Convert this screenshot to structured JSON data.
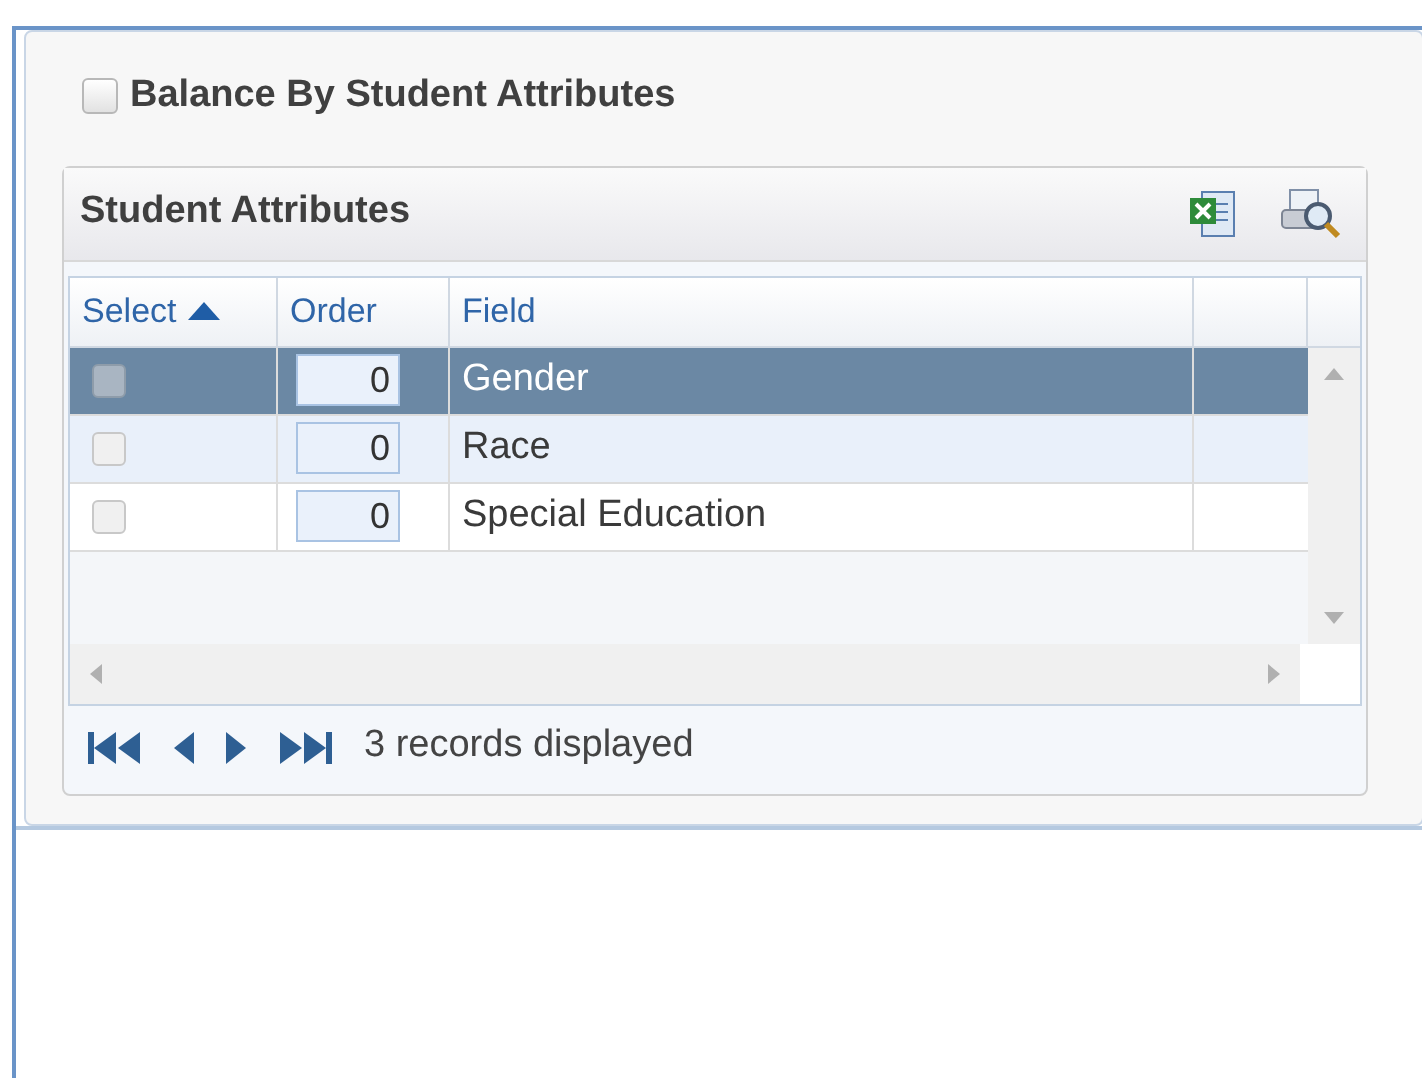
{
  "balance_option": {
    "label": "Balance By Student Attributes",
    "checked": false
  },
  "grid": {
    "title": "Student Attributes",
    "columns": [
      {
        "label": "Select",
        "sorted": true
      },
      {
        "label": "Order",
        "sorted": false
      },
      {
        "label": "Field",
        "sorted": false
      }
    ],
    "rows": [
      {
        "checked": false,
        "order": "0",
        "field": "Gender",
        "selected": true
      },
      {
        "checked": false,
        "order": "0",
        "field": "Race",
        "selected": false
      },
      {
        "checked": false,
        "order": "0",
        "field": "Special Education",
        "selected": false
      }
    ],
    "status": "3 records displayed"
  }
}
